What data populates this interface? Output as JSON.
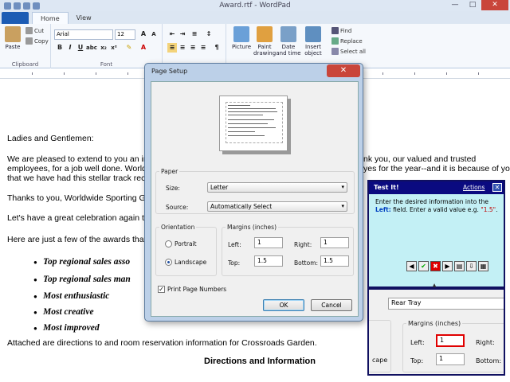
{
  "window": {
    "title": "Award.rtf - WordPad"
  },
  "tabs": [
    {
      "label": "Home"
    },
    {
      "label": "View"
    }
  ],
  "ribbon": {
    "clipboard": {
      "label": "Clipboard",
      "paste": "Paste",
      "cut": "Cut",
      "copy": "Copy"
    },
    "font": {
      "label": "Font",
      "family": "Arial",
      "size": "12"
    },
    "insert": {
      "picture": "Picture",
      "paint": "Paint drawing",
      "datetime": "Date and time",
      "object": "Insert object"
    },
    "editing": {
      "find": "Find",
      "replace": "Replace",
      "select_all": "Select all"
    }
  },
  "document": {
    "salutation": "Ladies and Gentlemen:",
    "p1_line1": "We are pleased to extend to you an invita",
    "p1_line1_end": "nk you, our valued and trusted",
    "p1_line2": "employees, for a job well done.  Worldwid",
    "p1_line2_end": "yes for the year--and it is because of you",
    "p1_line3": "that we have had this stellar track record",
    "p2": "Thanks to you, Worldwide Sporting Gooc",
    "p3": "Let's have a great celebration again this",
    "p4": "Here are just a few of the awards that will",
    "bullets": [
      "Top regional sales asso",
      "Top regional sales man",
      "Most enthusiastic",
      "Most creative",
      "Most improved"
    ],
    "p5": "Attached are directions to and room reservation information for Crossroads Garden.",
    "heading": "Directions and Information"
  },
  "page_setup": {
    "title": "Page Setup",
    "paper_label": "Paper",
    "size_label": "Size:",
    "size_value": "Letter",
    "source_label": "Source:",
    "source_value": "Automatically Select",
    "orientation_label": "Orientation",
    "portrait": "Portrait",
    "landscape": "Landscape",
    "orientation_selected": "Landscape",
    "margins_label": "Margins (inches)",
    "left_label": "Left:",
    "left_value": "1",
    "right_label": "Right:",
    "right_value": "1",
    "top_label": "Top:",
    "top_value": "1.5",
    "bottom_label": "Bottom:",
    "bottom_value": "1.5",
    "print_page_numbers": "Print Page Numbers",
    "print_page_numbers_checked": true,
    "ok": "OK",
    "cancel": "Cancel"
  },
  "testit": {
    "title": "Test It!",
    "actions": "Actions",
    "msg_1": "Enter the desired information into the",
    "msg_field": "Left:",
    "msg_2": " field. Enter a valid value e.g. ",
    "msg_value": "\"1.5\"",
    "msg_end": "."
  },
  "zoom": {
    "tray": "Rear Tray",
    "margins_label": "Margins (inches)",
    "left_label": "Left:",
    "left_value": "1",
    "right_label": "Right:",
    "top_label": "Top:",
    "top_value": "1",
    "bottom_label": "Bottom:",
    "partial": "cape"
  },
  "colors": {
    "accent": "#1c5cb4",
    "testit_bg": "#c3f0f5",
    "testit_head": "#0a0a80",
    "highlight": "#e00000"
  }
}
